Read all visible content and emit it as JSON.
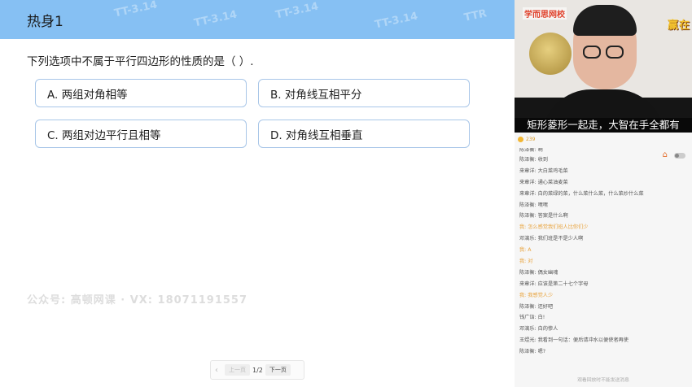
{
  "lesson": {
    "title": "热身1",
    "question": "下列选项中不属于平行四边形的性质的是（ ）.",
    "options": [
      {
        "label": "A.  两组对角相等"
      },
      {
        "label": "B.  对角线互相平分"
      },
      {
        "label": "C.  两组对边平行且相等"
      },
      {
        "label": "D.  对角线互相垂直"
      }
    ],
    "header_deco": [
      "TT-3.14",
      "TT-3.14",
      "TT-3.14",
      "TT-3.14",
      "TTR"
    ],
    "watermark": "公众号: 高顿网课 · VX: 18071191557",
    "pager": {
      "prev": "上一页",
      "page": "1/2",
      "next": "下一页"
    }
  },
  "video": {
    "logo": "学而思网校",
    "badge": "赢在",
    "caption": "矩形菱形一起走，大智在手全都有"
  },
  "chat": {
    "count": "239",
    "messages": [
      {
        "text": "陈泽衡: 啊",
        "highlight": false
      },
      {
        "text": "陈泽衡: 收到",
        "highlight": false
      },
      {
        "text": "来章洋: 大白菜鸡毛菜",
        "highlight": false
      },
      {
        "text": "来章洋: 通心菜油麦菜",
        "highlight": false
      },
      {
        "text": "来章洋: 白的菜绿的菜，什么菜什么菜，什么菜炒什么菜",
        "highlight": false
      },
      {
        "text": "陈泽衡: 嘿嘿",
        "highlight": false
      },
      {
        "text": "陈泽衡: 答案是什么啊",
        "highlight": false
      },
      {
        "text": "我: 怎么感觉我们班人比你们少",
        "highlight": true
      },
      {
        "text": "邓漓乐: 我们班是不是少人啊",
        "highlight": false
      },
      {
        "text": "我: A",
        "highlight": true
      },
      {
        "text": "我: 对",
        "highlight": true
      },
      {
        "text": "陈泽衡: 偶女幽魂",
        "highlight": false
      },
      {
        "text": "来章洋: 应该是第二十七个字母",
        "highlight": false
      },
      {
        "text": "我: 我感觉人少",
        "highlight": true
      },
      {
        "text": "陈泽衡: 还好吧",
        "highlight": false
      },
      {
        "text": "钱广诣: 白!",
        "highlight": false
      },
      {
        "text": "邓漓乐: 白的惨人",
        "highlight": false
      },
      {
        "text": "王煜光: 我看到一句话：便后请冲水以便使者再使",
        "highlight": false
      },
      {
        "text": "陈泽衡: 嗯?",
        "highlight": false
      }
    ],
    "footer": "观看回放时不能发送消息"
  },
  "colors": {
    "header_bg": "#86c0f3",
    "option_border": "#a8c6e8",
    "highlight": "#e8a23a"
  }
}
